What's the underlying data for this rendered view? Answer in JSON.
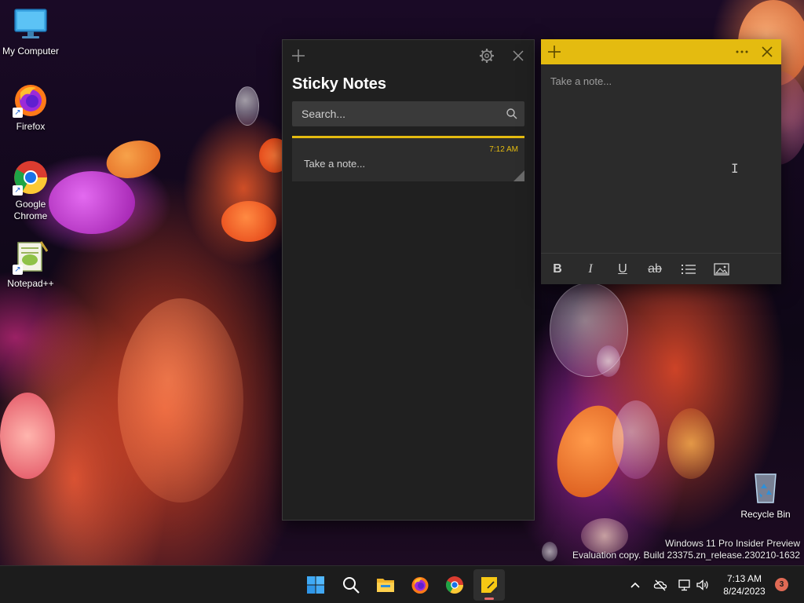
{
  "desktop": {
    "icons": [
      {
        "label": "My Computer",
        "icon": "monitor-icon"
      },
      {
        "label": "Firefox",
        "icon": "firefox-icon"
      },
      {
        "label": "Google Chrome",
        "icon": "chrome-icon"
      },
      {
        "label": "Notepad++",
        "icon": "notepad-plus-plus-icon"
      },
      {
        "label": "Recycle Bin",
        "icon": "recycle-bin-icon"
      }
    ]
  },
  "sticky_list": {
    "title": "Sticky Notes",
    "search_placeholder": "Search...",
    "notes": [
      {
        "time": "7:12 AM",
        "preview": "Take a note..."
      }
    ],
    "icons": {
      "new": "plus-icon",
      "settings": "gear-icon",
      "close": "close-icon",
      "search": "search-icon"
    }
  },
  "note_editor": {
    "placeholder": "Take a note...",
    "accent": "#e4bb10",
    "icons": {
      "new": "plus-icon",
      "menu": "more-icon",
      "close": "close-icon"
    },
    "format_buttons": [
      {
        "name": "bold",
        "label": "B"
      },
      {
        "name": "italic",
        "label": "I"
      },
      {
        "name": "underline",
        "label": "U"
      },
      {
        "name": "strikethrough",
        "label": "ab"
      },
      {
        "name": "bullets",
        "icon": "bullet-list-icon"
      },
      {
        "name": "image",
        "icon": "image-icon"
      }
    ]
  },
  "watermark": {
    "line1": "Windows 11 Pro Insider Preview",
    "line2": "Evaluation copy. Build 23375.zn_release.230210-1632"
  },
  "taskbar": {
    "apps": [
      "windows-start-icon",
      "search-icon",
      "file-explorer-icon",
      "firefox-icon",
      "chrome-icon",
      "sticky-notes-icon"
    ],
    "time": "7:13 AM",
    "date": "8/24/2023",
    "notification_count": "3"
  }
}
